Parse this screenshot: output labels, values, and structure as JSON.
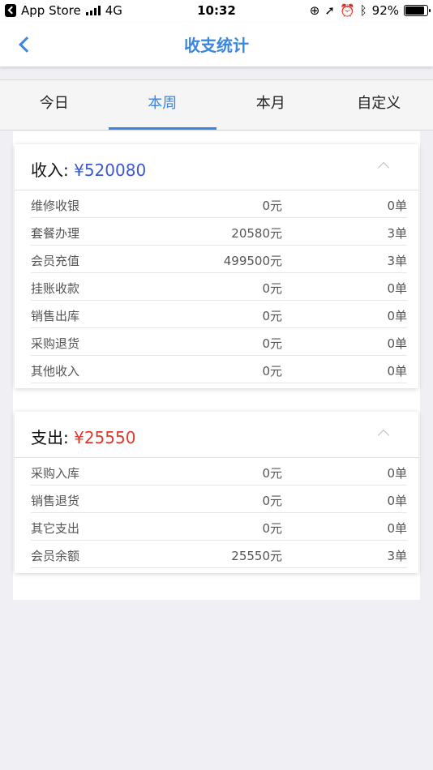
{
  "status_bar": {
    "back_app": "App Store",
    "network": "4G",
    "time": "10:32",
    "battery": "92%"
  },
  "nav": {
    "title": "收支统计"
  },
  "tabs": [
    {
      "label": "今日"
    },
    {
      "label": "本周"
    },
    {
      "label": "本月"
    },
    {
      "label": "自定义"
    }
  ],
  "active_tab": "本周",
  "income": {
    "label": "收入: ",
    "amount": "¥520080",
    "rows": [
      {
        "name": "维修收银",
        "money": "0元",
        "count": "0单"
      },
      {
        "name": "套餐办理",
        "money": "20580元",
        "count": "3单"
      },
      {
        "name": "会员充值",
        "money": "499500元",
        "count": "3单"
      },
      {
        "name": "挂账收款",
        "money": "0元",
        "count": "0单"
      },
      {
        "name": "销售出库",
        "money": "0元",
        "count": "0单"
      },
      {
        "name": "采购退货",
        "money": "0元",
        "count": "0单"
      },
      {
        "name": "其他收入",
        "money": "0元",
        "count": "0单"
      }
    ]
  },
  "expense": {
    "label": "支出: ",
    "amount": "¥25550",
    "rows": [
      {
        "name": "采购入库",
        "money": "0元",
        "count": "0单"
      },
      {
        "name": "销售退货",
        "money": "0元",
        "count": "0单"
      },
      {
        "name": "其它支出",
        "money": "0元",
        "count": "0单"
      },
      {
        "name": "会员余额",
        "money": "25550元",
        "count": "3单"
      }
    ]
  },
  "colors": {
    "accent": "#3b86e0",
    "income_amount": "#3a58d1",
    "expense_amount": "#e0382e"
  }
}
